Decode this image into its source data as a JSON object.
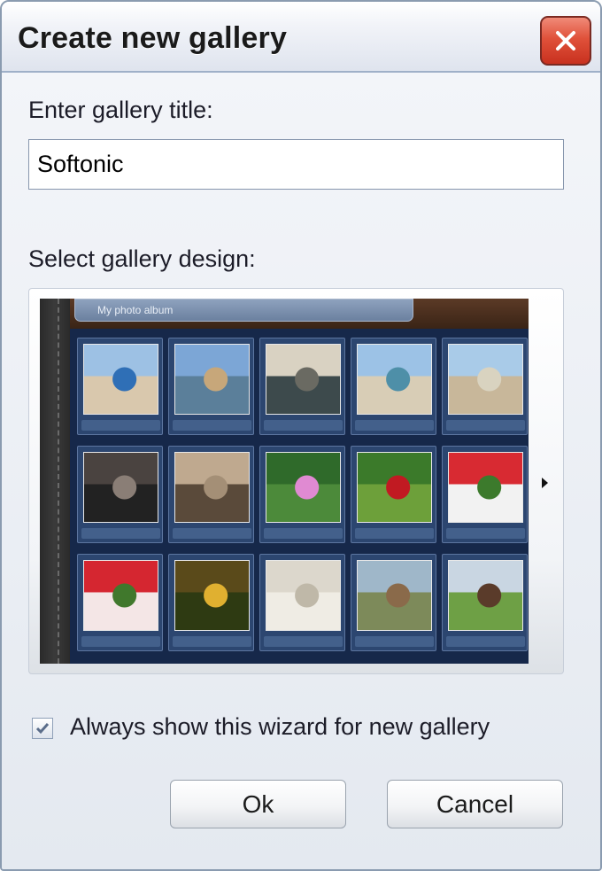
{
  "window": {
    "title": "Create new gallery",
    "close_icon": "close-icon"
  },
  "form": {
    "title_label": "Enter gallery title:",
    "title_value": "Softonic",
    "design_label": "Select gallery design:"
  },
  "preview": {
    "album_title": "My photo album",
    "thumbnails": [
      {
        "subject": "blue umbrella on beach",
        "palette": [
          "#9dc1e4",
          "#2f6fb6",
          "#d9c8ad"
        ]
      },
      {
        "subject": "beach with rocks",
        "palette": [
          "#7ca6d6",
          "#c7a77a",
          "#5b7f9a"
        ]
      },
      {
        "subject": "seaside rocks at dusk",
        "palette": [
          "#d9d2c2",
          "#6a6a62",
          "#3d4a4c"
        ]
      },
      {
        "subject": "sea horizon",
        "palette": [
          "#9cc2e6",
          "#4e8fa8",
          "#d8cdb6"
        ]
      },
      {
        "subject": "sandy beach",
        "palette": [
          "#a9cbe8",
          "#d9d3c0",
          "#c8b79a"
        ]
      },
      {
        "subject": "shell close-up",
        "palette": [
          "#4a4340",
          "#8a7e76",
          "#222"
        ]
      },
      {
        "subject": "sand hole",
        "palette": [
          "#bfa98f",
          "#a48f76",
          "#5a4a3a"
        ]
      },
      {
        "subject": "pink flower",
        "palette": [
          "#2f6a2a",
          "#e08ad2",
          "#4c8a3a"
        ]
      },
      {
        "subject": "red poppy",
        "palette": [
          "#3b7a2a",
          "#c11a22",
          "#6da03a"
        ]
      },
      {
        "subject": "strawberry plant",
        "palette": [
          "#d82a32",
          "#3c7a2c",
          "#f2f2f2"
        ]
      },
      {
        "subject": "strawberry close-up",
        "palette": [
          "#d52630",
          "#40782c",
          "#f4e6e6"
        ]
      },
      {
        "subject": "yellow bug on leaf",
        "palette": [
          "#5a4a1a",
          "#e0b030",
          "#2e3a12"
        ]
      },
      {
        "subject": "white fluff",
        "palette": [
          "#dcd7cc",
          "#bfb8a8",
          "#efece4"
        ]
      },
      {
        "subject": "horses in field",
        "palette": [
          "#9fb7c9",
          "#8a6a4a",
          "#7d8a5a"
        ]
      },
      {
        "subject": "horse on grass",
        "palette": [
          "#c9d6e2",
          "#5a3b2a",
          "#6ea045"
        ]
      }
    ]
  },
  "options": {
    "always_show_label": "Always show this wizard for new gallery",
    "always_show_checked": true
  },
  "buttons": {
    "ok_label": "Ok",
    "cancel_label": "Cancel"
  },
  "colors": {
    "title_bar": "#dfe4ee",
    "close_button": "#d9462f",
    "preview_background": "#16284a"
  }
}
